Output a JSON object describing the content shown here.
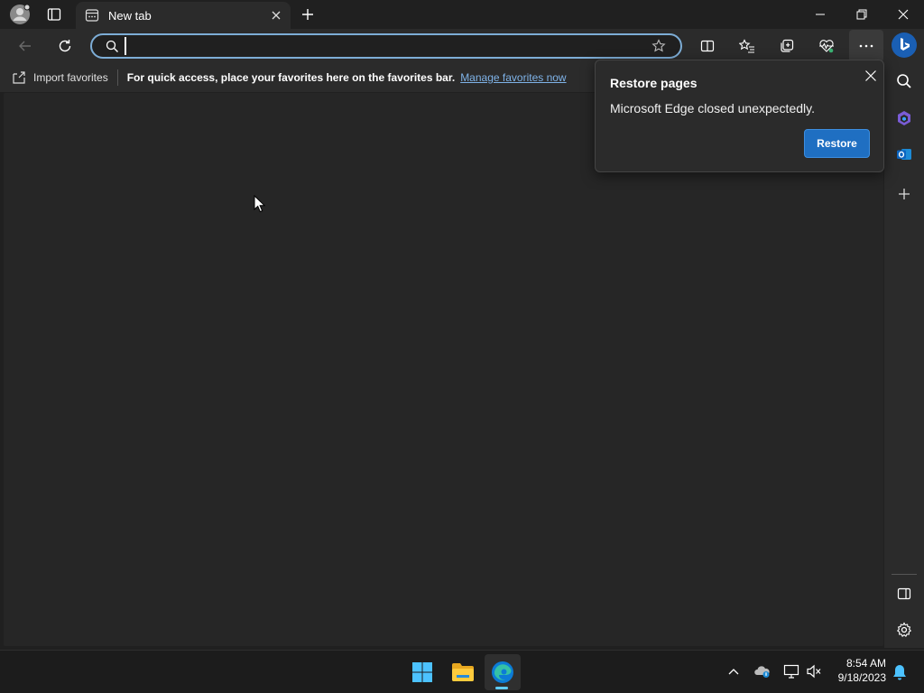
{
  "tabs": [
    {
      "title": "New tab"
    }
  ],
  "address_bar": {
    "value": "",
    "placeholder": ""
  },
  "favorites_bar": {
    "import_label": "Import favorites",
    "hint": "For quick access, place your favorites here on the favorites bar.",
    "manage_link": "Manage favorites now"
  },
  "popup": {
    "title": "Restore pages",
    "message": "Microsoft Edge closed unexpectedly.",
    "restore_label": "Restore"
  },
  "taskbar": {
    "time": "8:54 AM",
    "date": "9/18/2023"
  },
  "colors": {
    "accent": "#1f6fc2",
    "address_focus": "#7dadd6",
    "link": "#7fb3e8"
  }
}
